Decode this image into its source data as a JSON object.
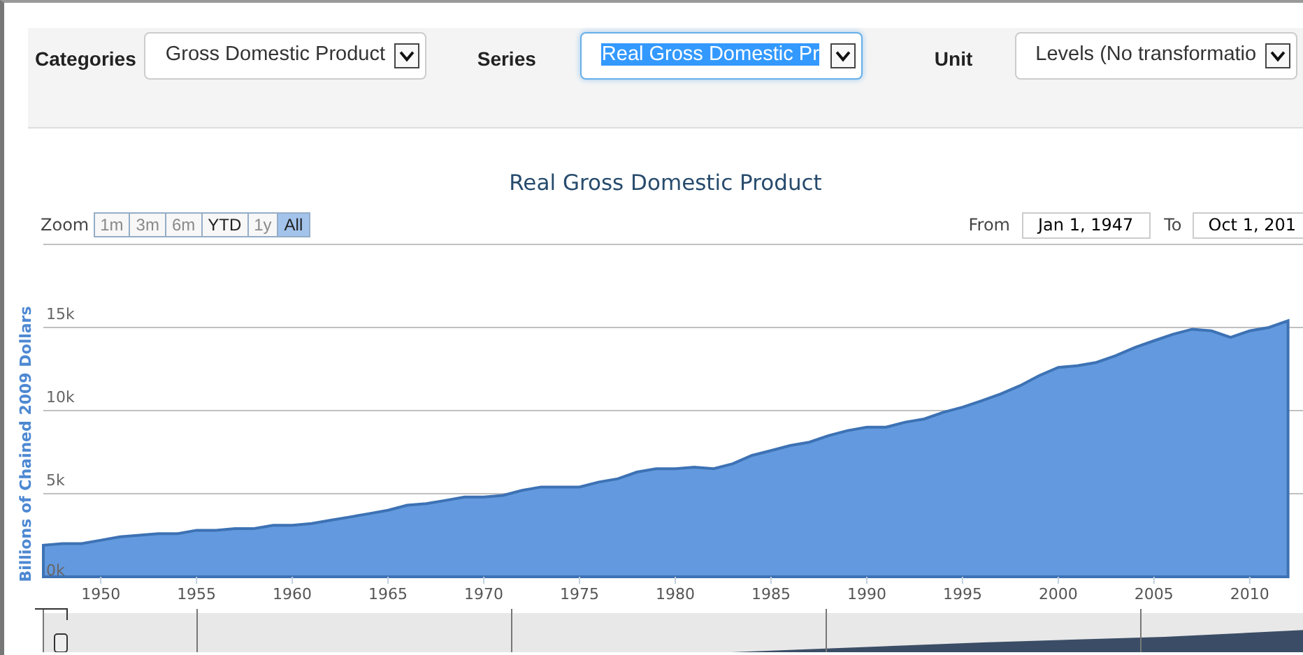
{
  "filters": [
    {
      "label": "Categories",
      "value": "Gross Domestic Product",
      "focused": false
    },
    {
      "label": "Series",
      "value": "Real Gross Domestic Pr",
      "focused": true
    },
    {
      "label": "Unit",
      "value": "Levels (No transformatio",
      "focused": false
    }
  ],
  "chart": {
    "zoom_label": "Zoom",
    "zoom_buttons": [
      {
        "label": "1m",
        "disabled": true,
        "selected": false
      },
      {
        "label": "3m",
        "disabled": true,
        "selected": false
      },
      {
        "label": "6m",
        "disabled": true,
        "selected": false
      },
      {
        "label": "YTD",
        "disabled": false,
        "selected": false
      },
      {
        "label": "1y",
        "disabled": true,
        "selected": false
      },
      {
        "label": "All",
        "disabled": false,
        "selected": true
      }
    ],
    "from_label": "From",
    "from_value": "Jan 1, 1947",
    "to_label": "To",
    "to_value": "Oct 1, 201",
    "chart_data": {
      "type": "area",
      "title": "Real Gross Domestic Product",
      "ylabel": "Billions of Chained 2009 Dollars",
      "x": [
        1947,
        1948,
        1949,
        1950,
        1951,
        1952,
        1953,
        1954,
        1955,
        1956,
        1957,
        1958,
        1959,
        1960,
        1961,
        1962,
        1963,
        1964,
        1965,
        1966,
        1967,
        1968,
        1969,
        1970,
        1971,
        1972,
        1973,
        1974,
        1975,
        1976,
        1977,
        1978,
        1979,
        1980,
        1981,
        1982,
        1983,
        1984,
        1985,
        1986,
        1987,
        1988,
        1989,
        1990,
        1991,
        1992,
        1993,
        1994,
        1995,
        1996,
        1997,
        1998,
        1999,
        2000,
        2001,
        2002,
        2003,
        2004,
        2005,
        2006,
        2007,
        2008,
        2009,
        2010,
        2011,
        2012
      ],
      "series": [
        {
          "color": "#6399de",
          "values": [
            1900,
            2000,
            2000,
            2200,
            2400,
            2500,
            2600,
            2600,
            2800,
            2800,
            2900,
            2900,
            3100,
            3100,
            3200,
            3400,
            3600,
            3800,
            4000,
            4300,
            4400,
            4600,
            4800,
            4800,
            4900,
            5200,
            5400,
            5400,
            5400,
            5700,
            5900,
            6300,
            6500,
            6500,
            6600,
            6500,
            6800,
            7300,
            7600,
            7900,
            8100,
            8500,
            8800,
            9000,
            9000,
            9300,
            9500,
            9900,
            10200,
            10600,
            11000,
            11500,
            12100,
            12600,
            12700,
            12900,
            13300,
            13800,
            14200,
            14600,
            14900,
            14800,
            14400,
            14800,
            15000,
            15400
          ]
        }
      ],
      "grid": true,
      "xlim": [
        1947,
        2013
      ],
      "ylim": [
        0,
        20000
      ],
      "xticks": [
        1950,
        1955,
        1960,
        1965,
        1970,
        1975,
        1980,
        1985,
        1990,
        1995,
        2000,
        2005,
        2010
      ],
      "yticks": [
        {
          "value": 0,
          "label": "0k"
        },
        {
          "value": 5000,
          "label": "5k"
        },
        {
          "value": 10000,
          "label": "10k"
        },
        {
          "value": 15000,
          "label": "15k"
        }
      ]
    }
  }
}
